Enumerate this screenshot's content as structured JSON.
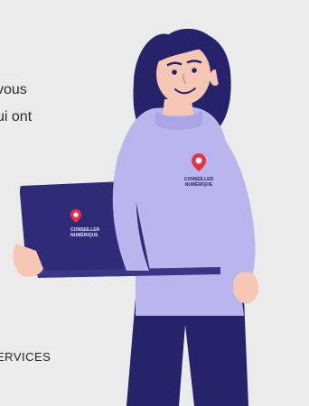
{
  "intro": {
    "line1_fragment": "vous",
    "line2_fragment": "ui ont"
  },
  "logo": {
    "line1": "CONSEILLER",
    "line2": "NUMÉRIQUE"
  },
  "footer": {
    "fragment": "ERVICES"
  },
  "colors": {
    "background": "#ebebeb",
    "sweater": "#b9b6ee",
    "hair": "#27236b",
    "laptop": "#2f2b76",
    "skin": "#f6c7b4",
    "accent_red": "#e5343f"
  }
}
